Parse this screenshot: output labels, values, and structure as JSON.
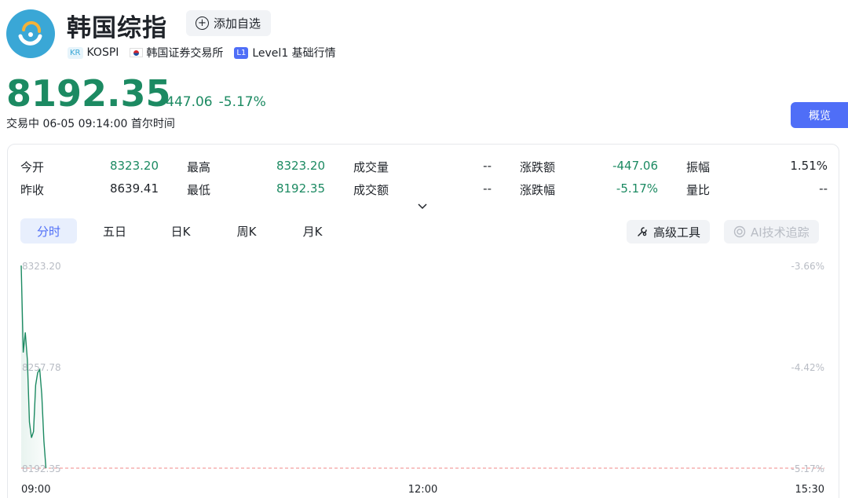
{
  "header": {
    "title": "韩国综指",
    "add_watchlist": "添加自选",
    "tags": {
      "kr_badge": "KR",
      "code": "KOSPI",
      "exchange": "韩国证券交易所",
      "level_badge": "L1",
      "level_text": "Level1 基础行情"
    }
  },
  "quote": {
    "price": "8192.35",
    "change": "-447.06",
    "change_pct": "-5.17%",
    "status": "交易中  06-05 09:14:00  首尔时间"
  },
  "overview_button": "概览",
  "stats": {
    "row1": [
      {
        "label": "今开",
        "value": "8323.20"
      },
      {
        "label": "最高",
        "value": "8323.20"
      },
      {
        "label": "成交量",
        "value": "--"
      },
      {
        "label": "涨跌额",
        "value": "-447.06"
      },
      {
        "label": "振幅",
        "value": "1.51%"
      }
    ],
    "row2": [
      {
        "label": "昨收",
        "value": "8639.41"
      },
      {
        "label": "最低",
        "value": "8192.35"
      },
      {
        "label": "成交额",
        "value": "--"
      },
      {
        "label": "涨跌幅",
        "value": "-5.17%"
      },
      {
        "label": "量比",
        "value": "--"
      }
    ]
  },
  "tabs": [
    "分时",
    "五日",
    "日K",
    "周K",
    "月K"
  ],
  "active_tab": "分时",
  "tools": {
    "advanced": "高级工具",
    "ai": "AI技术追踪"
  },
  "colors": {
    "down": "#1c8a62",
    "accent": "#4f6ef7",
    "logo": "#3aa7d6"
  },
  "chart_data": {
    "type": "line",
    "y_left_ticks": [
      "8323.20",
      "8257.78",
      "8192.35"
    ],
    "y_right_ticks": [
      "-3.66%",
      "-4.42%",
      "-5.17%"
    ],
    "x_ticks": [
      "09:00",
      "12:00",
      "15:30"
    ],
    "ylim": [
      8192.35,
      8323.2
    ],
    "reference_line": 8192.35,
    "series": [
      {
        "values": [
          {
            "t": "09:00",
            "v": 8323.2
          },
          {
            "t": "09:01",
            "v": 8267.0
          },
          {
            "t": "09:02",
            "v": 8280.0
          },
          {
            "t": "09:03",
            "v": 8262.0
          },
          {
            "t": "09:04",
            "v": 8222.0
          },
          {
            "t": "09:05",
            "v": 8212.0
          },
          {
            "t": "09:06",
            "v": 8216.0
          },
          {
            "t": "09:07",
            "v": 8246.0
          },
          {
            "t": "09:08",
            "v": 8254.0
          },
          {
            "t": "09:09",
            "v": 8256.0
          },
          {
            "t": "09:10",
            "v": 8240.0
          },
          {
            "t": "09:11",
            "v": 8210.0
          },
          {
            "t": "09:12",
            "v": 8192.35
          }
        ]
      }
    ]
  }
}
